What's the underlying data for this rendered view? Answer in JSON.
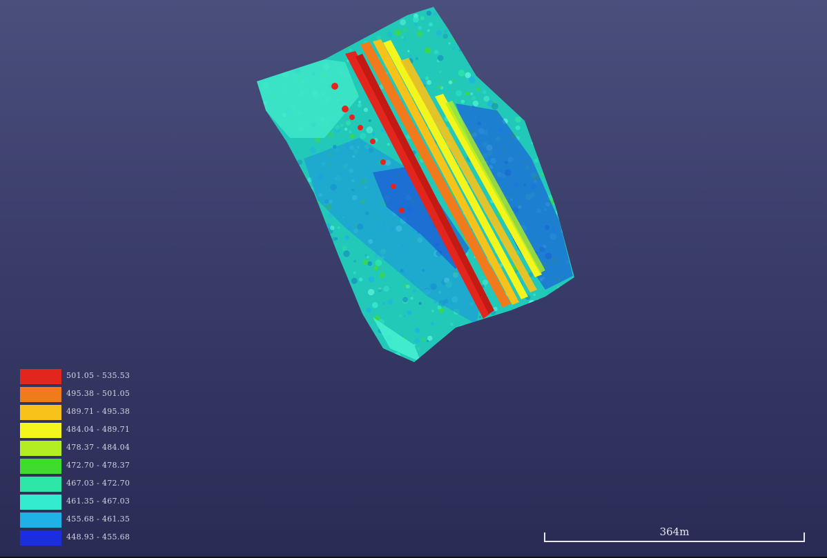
{
  "viewer": {
    "background_top": "#4b4f7c",
    "background_bottom": "#2a2b55"
  },
  "legend": {
    "items": [
      {
        "label": "501.05 - 535.53",
        "color": "#e3261d"
      },
      {
        "label": "495.38 - 501.05",
        "color": "#f07a1c"
      },
      {
        "label": "489.71 - 495.38",
        "color": "#f7c21a"
      },
      {
        "label": "484.04 - 489.71",
        "color": "#f5f51e"
      },
      {
        "label": "478.37 - 484.04",
        "color": "#b2ee22"
      },
      {
        "label": "472.70 - 478.37",
        "color": "#3fdc2e"
      },
      {
        "label": "467.03 - 472.70",
        "color": "#2ee6a8"
      },
      {
        "label": "461.35 - 467.03",
        "color": "#35ebcf"
      },
      {
        "label": "455.68 - 461.35",
        "color": "#1fb2e6"
      },
      {
        "label": "448.93 - 455.68",
        "color": "#1b2de0"
      }
    ]
  },
  "scale_bar": {
    "label": "364m"
  },
  "colors": {
    "red": "#e3261d",
    "orange": "#f07a1c",
    "yellow_orange": "#f7c21a",
    "yellow": "#f5f51e",
    "green": "#3fdc2e",
    "teal": "#2ee6a8",
    "cyan": "#35ebcf",
    "sky": "#1fb2e6",
    "blue": "#1b2de0"
  }
}
